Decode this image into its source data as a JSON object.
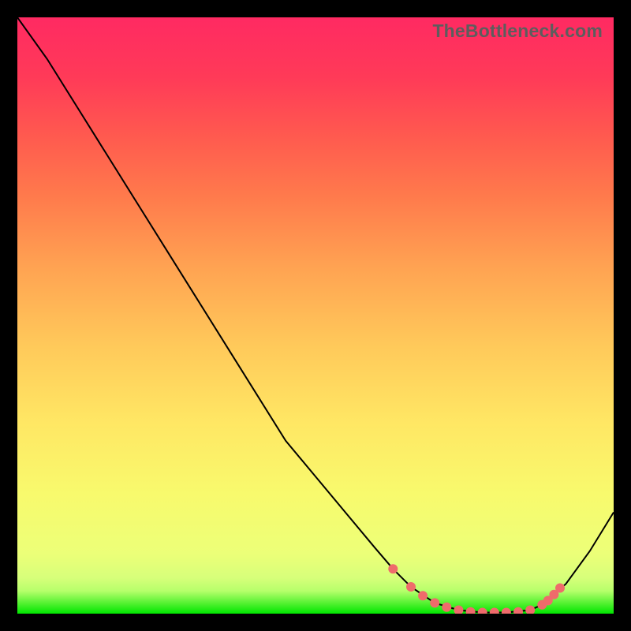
{
  "branding": {
    "text": "TheBottleneck.com"
  },
  "colors": {
    "curve": "#000000",
    "dot": "#ef6b6b",
    "background": "#000000"
  },
  "chart_data": {
    "type": "line",
    "title": "",
    "xlabel": "",
    "ylabel": "",
    "xlim": [
      0,
      100
    ],
    "ylim": [
      0,
      100
    ],
    "grid": false,
    "legend": false,
    "annotations": [],
    "series": [
      {
        "name": "bottleneck-curve",
        "x": [
          0,
          5,
          10,
          15,
          20,
          25,
          30,
          35,
          40,
          45,
          50,
          55,
          60,
          63,
          66,
          70,
          74,
          78,
          82,
          86,
          88,
          92,
          96,
          100
        ],
        "y": [
          100,
          93,
          85,
          77,
          69,
          61,
          53,
          45,
          37,
          29,
          23,
          17,
          11,
          7.5,
          4.5,
          1.8,
          0.6,
          0.2,
          0.2,
          0.6,
          1.5,
          5,
          10.5,
          17
        ]
      }
    ],
    "markers": {
      "name": "highlighted-points",
      "x": [
        63,
        66,
        68,
        70,
        72,
        74,
        76,
        78,
        80,
        82,
        84,
        86,
        88,
        89,
        90,
        91
      ],
      "y": [
        7.5,
        4.5,
        3.0,
        1.8,
        1.1,
        0.6,
        0.3,
        0.2,
        0.2,
        0.2,
        0.3,
        0.6,
        1.5,
        2.2,
        3.2,
        4.3
      ]
    }
  }
}
